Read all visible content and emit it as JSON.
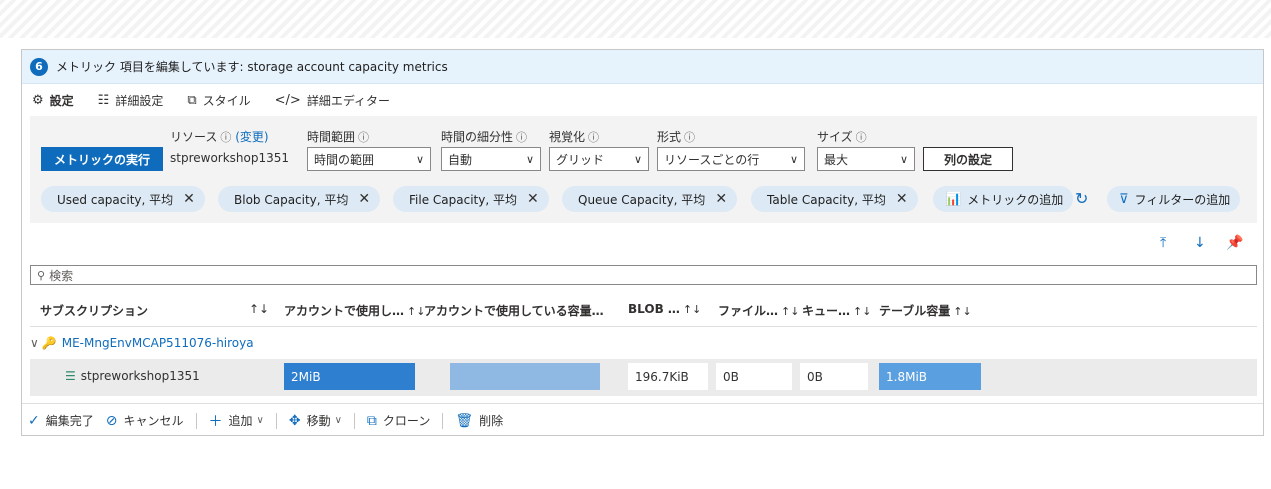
{
  "header": {
    "step": "6",
    "title": "メトリック 項目を編集しています: storage account capacity metrics"
  },
  "tabs": [
    {
      "label": "設定",
      "icon": "gear-icon"
    },
    {
      "label": "詳細設定",
      "icon": "sliders-icon"
    },
    {
      "label": "スタイル",
      "icon": "style-icon"
    },
    {
      "label": "詳細エディター",
      "icon": "code-icon"
    }
  ],
  "settings": {
    "run_button": "メトリックの実行",
    "resource_label": "リソース",
    "resource_change": "(変更)",
    "resource_name": "stpreworkshop1351",
    "time_range_label": "時間範囲",
    "time_range_value": "時間の範囲",
    "granularity_label": "時間の細分性",
    "granularity_value": "自動",
    "visualization_label": "視覚化",
    "visualization_value": "グリッド",
    "format_label": "形式",
    "format_value": "リソースごとの行",
    "size_label": "サイズ",
    "size_value": "最大",
    "column_settings": "列の設定",
    "info_glyph": "ⓘ"
  },
  "metrics": [
    {
      "label": "Used capacity, 平均"
    },
    {
      "label": "Blob Capacity, 平均"
    },
    {
      "label": "File Capacity, 平均"
    },
    {
      "label": "Queue Capacity, 平均"
    },
    {
      "label": "Table Capacity, 平均"
    }
  ],
  "add_metric": "メトリックの追加",
  "add_filter": "フィルターの追加",
  "search": {
    "placeholder": "検索"
  },
  "grid": {
    "columns": [
      "サブスクリプション",
      "アカウントで使用し…",
      "アカウントで使用している容量…",
      "BLOB …",
      "ファイル…",
      "キュー…",
      "テーブル容量"
    ],
    "sort_glyph": "↑↓",
    "group": "ME-MngEnvMCAP511076-hiroya",
    "row": {
      "resource": "stpreworkshop1351",
      "used": "2MiB",
      "used_bar": "",
      "blob": "196.7KiB",
      "file": "0B",
      "queue": "0B",
      "table": "1.8MiB"
    }
  },
  "footer": {
    "done": "編集完了",
    "cancel": "キャンセル",
    "add": "追加",
    "move": "移動",
    "clone": "クローン",
    "delete": "削除"
  },
  "colors": {
    "accent": "#0f6cbd",
    "bar_dark": "#2f7fd0",
    "bar_light": "#8fb8e2",
    "bar_mid": "#5aa0e0",
    "pill_bg": "#dde9f5"
  }
}
